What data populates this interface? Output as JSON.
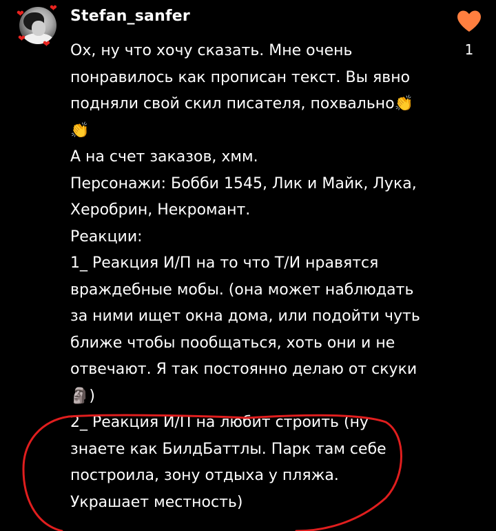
{
  "comment": {
    "username": "Stefan_sanfer",
    "text": "Ох, ну что хочу сказать. Мне очень понравилось как прописан текст. Вы явно подняли свой скил писателя, похвально👏👏\nА на счет заказов, хмм.\nПерсонажи: Бобби 1545, Лик и Майк, Лука, Херобрин, Некромант.\nРеакции:\n1_ Реакция И/П на то что Т/И нравятся враждебные мобы. (она может наблюдать за ними ищет окна дома, или подойти чуть ближе чтобы пообщаться, хоть они и не отвечают. Я так постоянно делаю от скуки🗿)\n2_ Реакция И/П на любит строить (ну знаете как БилдБаттлы. Парк там себе построила, зону отдыха у пляжа. Украшает местность)",
    "like_count": "1",
    "like_icon": "heart-icon",
    "accent_color": "#ff7f3f",
    "annotation_color": "#e01e1e"
  }
}
